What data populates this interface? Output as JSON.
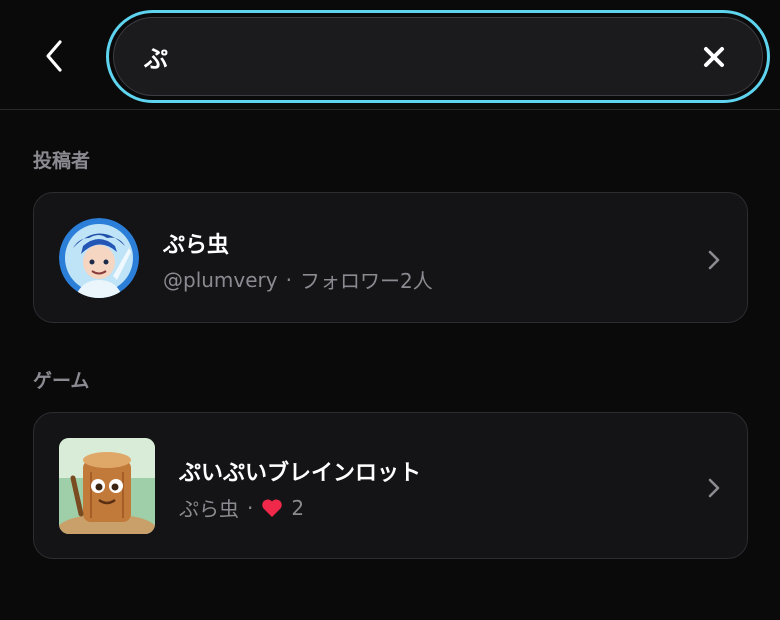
{
  "search": {
    "value": "ぷ"
  },
  "sections": {
    "creators_label": "投稿者",
    "games_label": "ゲーム"
  },
  "creator": {
    "name": "ぷら虫",
    "handle": "@plumvery",
    "separator": "·",
    "followers": "フォロワー2人"
  },
  "game": {
    "title": "ぷいぷいブレインロット",
    "author": "ぷら虫",
    "separator": "·",
    "likes": "2"
  },
  "colors": {
    "accent_ring": "#5ed4ee",
    "heart": "#f0284a",
    "muted_text": "#8a8a90",
    "card_bg": "#141417"
  },
  "icons": {
    "back": "chevron-left-icon",
    "clear": "close-icon",
    "row_arrow": "chevron-right-icon",
    "like": "heart-icon"
  }
}
